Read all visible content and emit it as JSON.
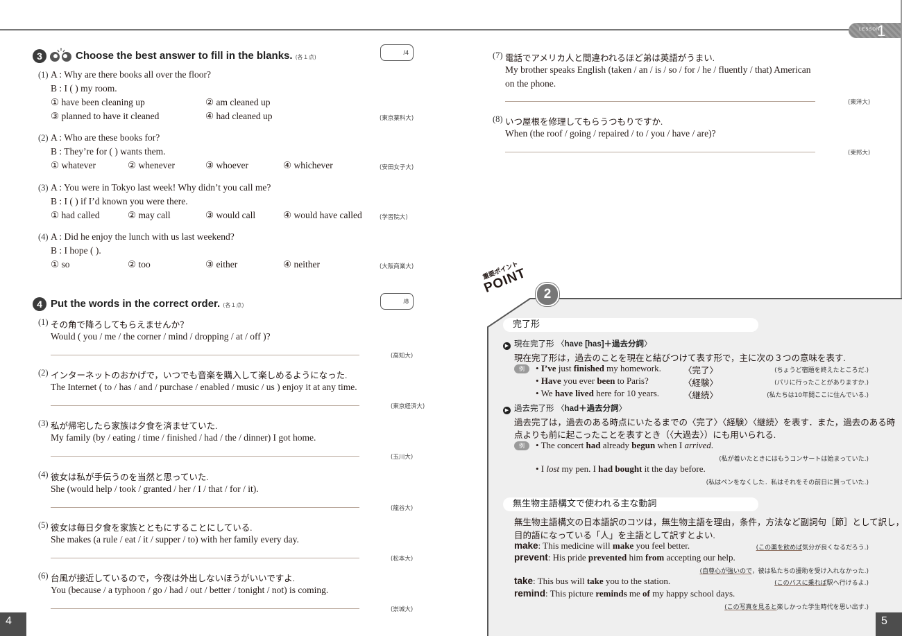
{
  "header": {
    "lesson_label": "LESSON",
    "lesson_number": "1"
  },
  "section3": {
    "number": "3",
    "title": "Choose the best answer to fill in the blanks.",
    "points_note": "(各１点)",
    "score": "/4",
    "items": [
      {
        "num": "(1)",
        "a": "A : Why are there books all over the floor?",
        "b": "B : I (          ) my room.",
        "options": [
          "① have been cleaning up",
          "② am cleaned up",
          "③ planned to have it cleaned",
          "④ had cleaned up"
        ],
        "school": "(東京薬科大)"
      },
      {
        "num": "(2)",
        "a": "A : Who are these books for?",
        "b": "B : They’re for (          ) wants them.",
        "options": [
          "① whatever",
          "② whenever",
          "③ whoever",
          "④ whichever"
        ],
        "school": "(安田女子大)"
      },
      {
        "num": "(3)",
        "a": "A : You were in Tokyo last week!  Why didn’t you call me?",
        "b": "B : I (          ) if I’d known you were there.",
        "options": [
          "① had called",
          "② may call",
          "③ would call",
          "④ would have called"
        ],
        "school": "(学習院大)"
      },
      {
        "num": "(4)",
        "a": "A : Did he enjoy the lunch with us last weekend?",
        "b": "B : I hope (          ).",
        "options": [
          "① so",
          "② too",
          "③ either",
          "④ neither"
        ],
        "school": "(大阪商業大)"
      }
    ]
  },
  "section4": {
    "number": "4",
    "title": "Put the words in the correct order.",
    "points_note": "(各１点)",
    "score": "/8",
    "items": [
      {
        "num": "(1)",
        "jp": "その角で降ろしてもらえませんか？",
        "en": "Would ( you / me / the corner / mind / dropping / at / off )?",
        "school": "(高知大)"
      },
      {
        "num": "(2)",
        "jp": "インターネットのおかげで，いつでも音楽を購入して楽しめるようになった.",
        "en": "The Internet ( to / has / and / purchase / enabled / music / us ) enjoy it at any time.",
        "school": "(東京経済大)"
      },
      {
        "num": "(3)",
        "jp": "私が帰宅したら家族は夕食を済ませていた.",
        "en": "My family  (by / eating / time / finished / had / the / dinner)  I got home.",
        "school": "(玉川大)"
      },
      {
        "num": "(4)",
        "jp": "彼女は私が手伝うのを当然と思っていた.",
        "en": "She  (would help / took / granted / her / I / that / for / it).",
        "school": "(龍谷大)"
      },
      {
        "num": "(5)",
        "jp": "彼女は毎日夕食を家族とともにすることにしている.",
        "en": "She makes  (a rule / eat / it / supper / to)  with her family every day.",
        "school": "(松本大)"
      },
      {
        "num": "(6)",
        "jp": "台風が接近しているので，今夜は外出しないほうがいいですよ.",
        "en": "You  (because / a typhoon / go / had / out / better / tonight / not)  is coming.",
        "school": "(崇城大)"
      },
      {
        "num": "(7)",
        "jp": "電話でアメリカ人と間違われるほど弟は英語がうまい.",
        "en": "My brother speaks English  (taken / an / is / so / for / he / fluently / that)  American",
        "en2": "on the phone.",
        "school": "(東洋大)"
      },
      {
        "num": "(8)",
        "jp": "いつ屋根を修理してもらうつもりですか.",
        "en": "When  (the roof / going / repaired / to / you / have / are)?",
        "school": "(東邦大)"
      }
    ]
  },
  "point": {
    "banner_small": "重要ポイント",
    "banner_big": "POINT",
    "number": "2",
    "example_label": "例",
    "topic1": {
      "title": "完了形",
      "sub1": {
        "heading_jp": "現在完了形 〈",
        "heading_bold": "have [has]＋過去分詞",
        "heading_end": "〉",
        "text": "現在完了形は，過去のことを現在と結びつけて表す形で，主に次の３つの意味を表す.",
        "examples": [
          {
            "segs": [
              [
                "• ",
                0
              ],
              [
                "I’ve",
                1
              ],
              [
                " just ",
                0
              ],
              [
                "finished",
                1
              ],
              [
                " my homework.",
                0
              ]
            ],
            "tag": "〈完了〉",
            "tr": "(ちょうど宿題を終えたところだ.)"
          },
          {
            "segs": [
              [
                "• ",
                0
              ],
              [
                "Have",
                1
              ],
              [
                " you ever ",
                0
              ],
              [
                "been",
                1
              ],
              [
                " to Paris?",
                0
              ]
            ],
            "tag": "〈経験〉",
            "tr": "(パリに行ったことがありますか.)"
          },
          {
            "segs": [
              [
                "• We ",
                0
              ],
              [
                "have lived",
                1
              ],
              [
                " here for 10 years.",
                0
              ]
            ],
            "tag": "〈継続〉",
            "tr": "(私たちは10年間ここに住んでいる.)"
          }
        ]
      },
      "sub2": {
        "heading_jp": "過去完了形 〈",
        "heading_bold": "had＋過去分詞",
        "heading_end": "〉",
        "text1": "過去完了は，過去のある時点にいたるまでの〈完了〉〈経験〉〈継続〉を表す．また，過去のある時",
        "text2": "点よりも前に起こったことを表すとき（〈大過去〉）にも用いられる.",
        "examples": [
          {
            "segs": [
              [
                "• The concert ",
                0
              ],
              [
                "had",
                1
              ],
              [
                " already ",
                0
              ],
              [
                "begun",
                1
              ],
              [
                " when I ",
                0
              ],
              [
                "arrived",
                2
              ],
              [
                ".",
                0
              ]
            ],
            "tr": "(私が着いたときにはもうコンサートは始まっていた.)"
          },
          {
            "segs": [
              [
                "• I ",
                0
              ],
              [
                "lost",
                2
              ],
              [
                " my pen.  I ",
                0
              ],
              [
                "had bought",
                1
              ],
              [
                " it the day before.",
                0
              ]
            ],
            "tr": "(私はペンをなくした．私はそれをその前日に買っていた.)"
          }
        ]
      }
    },
    "topic2": {
      "title": "無生物主語構文で使われる主な動詞",
      "text1": "無生物主語構文の日本語訳のコツは，無生物主語を理由，条件，方法など副詞句［節］として訳し，",
      "text2": "目的語になっている「人」を主語として訳すとよい.",
      "verbs": [
        {
          "verb": "make",
          "segs": [
            [
              ": This medicine will ",
              0
            ],
            [
              "make",
              1
            ],
            [
              " you feel better.",
              0
            ]
          ],
          "tr_u": "(この薬を飲めば",
          "tr_rest": "気分が良くなるだろう.)"
        },
        {
          "verb": "prevent",
          "segs": [
            [
              ": His pride ",
              0
            ],
            [
              "prevented",
              1
            ],
            [
              " him ",
              0
            ],
            [
              "from",
              1
            ],
            [
              " accepting our help.",
              0
            ]
          ],
          "tr_u": "(自尊心が強いので",
          "tr_rest": "，彼は私たちの援助を受け入れなかった.)"
        },
        {
          "verb": "take",
          "segs": [
            [
              ": This bus will ",
              0
            ],
            [
              "take",
              1
            ],
            [
              " you to the station.",
              0
            ]
          ],
          "tr_u": "(このバスに乗れば",
          "tr_rest": "駅へ行けるよ.)"
        },
        {
          "verb": "remind",
          "segs": [
            [
              ": This picture ",
              0
            ],
            [
              "reminds",
              1
            ],
            [
              " me ",
              0
            ],
            [
              "of",
              1
            ],
            [
              " my happy school days.",
              0
            ]
          ],
          "tr_u": "(この写真を見ると",
          "tr_rest": "楽しかった学生時代を思い出す.)"
        }
      ]
    }
  },
  "footer": {
    "left_page": "4",
    "right_page": "5"
  },
  "colors": {
    "badge": "#3a3a3a",
    "point_bg": "#efefef",
    "answer_line": "#b9a89c",
    "page_tab": "#4d4d4d"
  }
}
